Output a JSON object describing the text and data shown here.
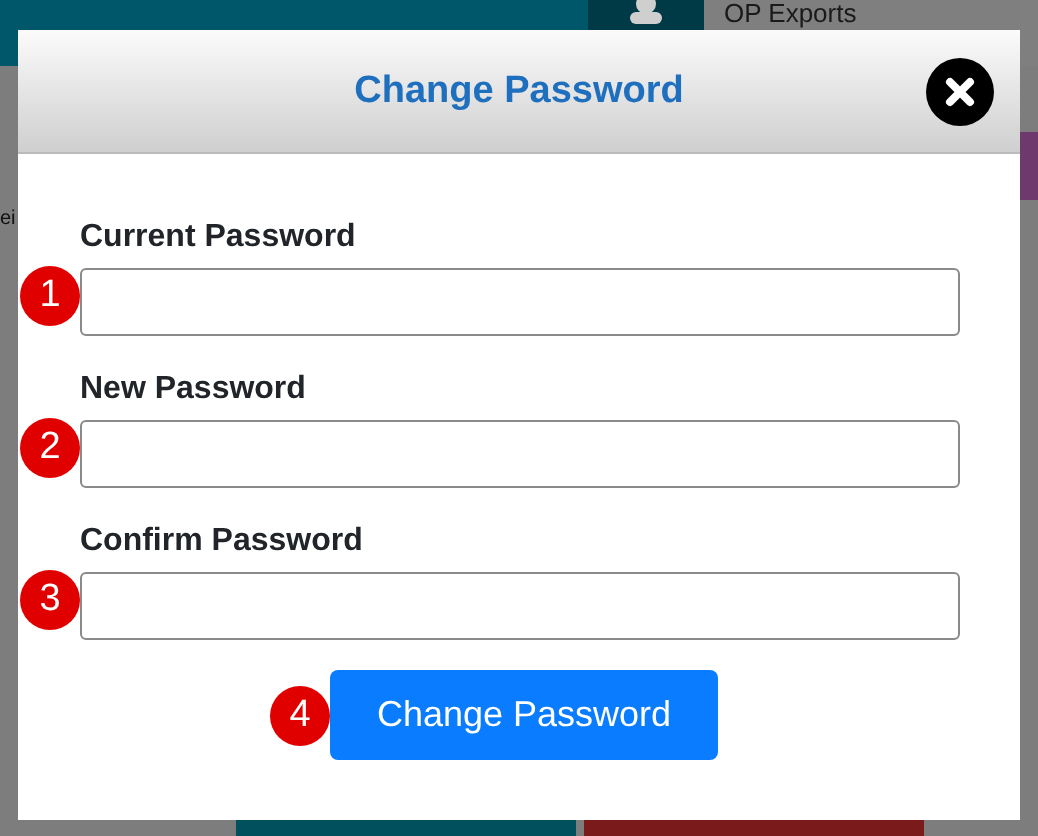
{
  "background": {
    "account": "OP Exports",
    "side_text": "ei"
  },
  "dialog": {
    "title": "Change Password",
    "fields": [
      {
        "step": "1",
        "label": "Current Password"
      },
      {
        "step": "2",
        "label": "New Password"
      },
      {
        "step": "3",
        "label": "Confirm Password"
      }
    ],
    "submit": {
      "step": "4",
      "label": "Change Password"
    }
  }
}
